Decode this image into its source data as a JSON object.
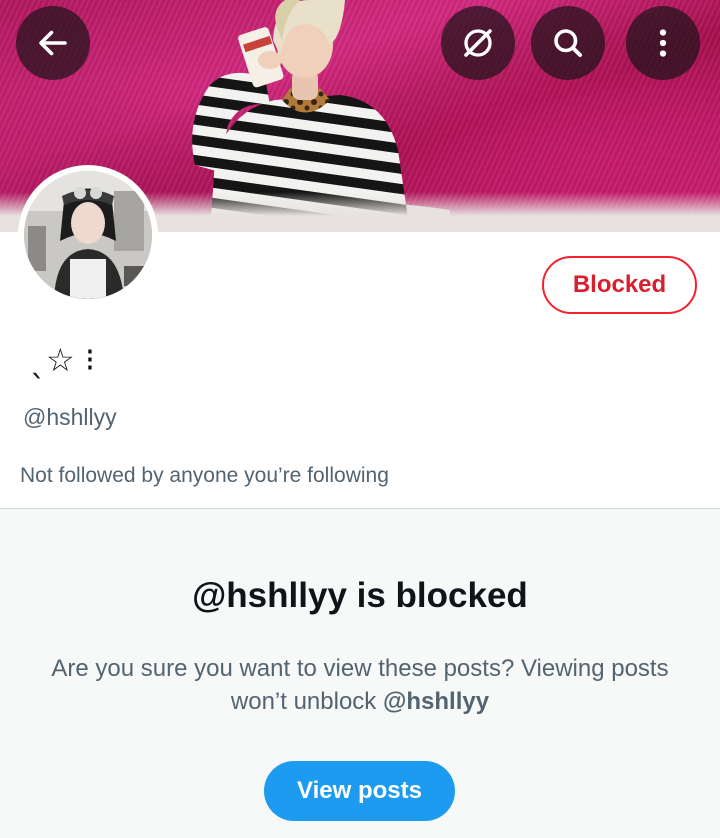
{
  "header": {
    "back_icon": "back-arrow-icon",
    "grok_icon": "grok-icon",
    "search_icon": "search-icon",
    "more_icon": "more-vertical-icon"
  },
  "profile": {
    "display_name": "ˎ☆ ⁝",
    "handle": "@hshllyy",
    "followers_note": "Not followed by anyone you’re following",
    "blocked_button_label": "Blocked"
  },
  "blocked_panel": {
    "title": "@hshllyy is blocked",
    "description_prefix": "Are you sure you want to view these posts? Viewing posts won’t unblock ",
    "description_handle": "@hshllyy",
    "view_posts_label": "View posts"
  },
  "colors": {
    "blocked_red": "#f4212e",
    "accent_blue": "#1d9bf0",
    "secondary_text": "#536471"
  }
}
